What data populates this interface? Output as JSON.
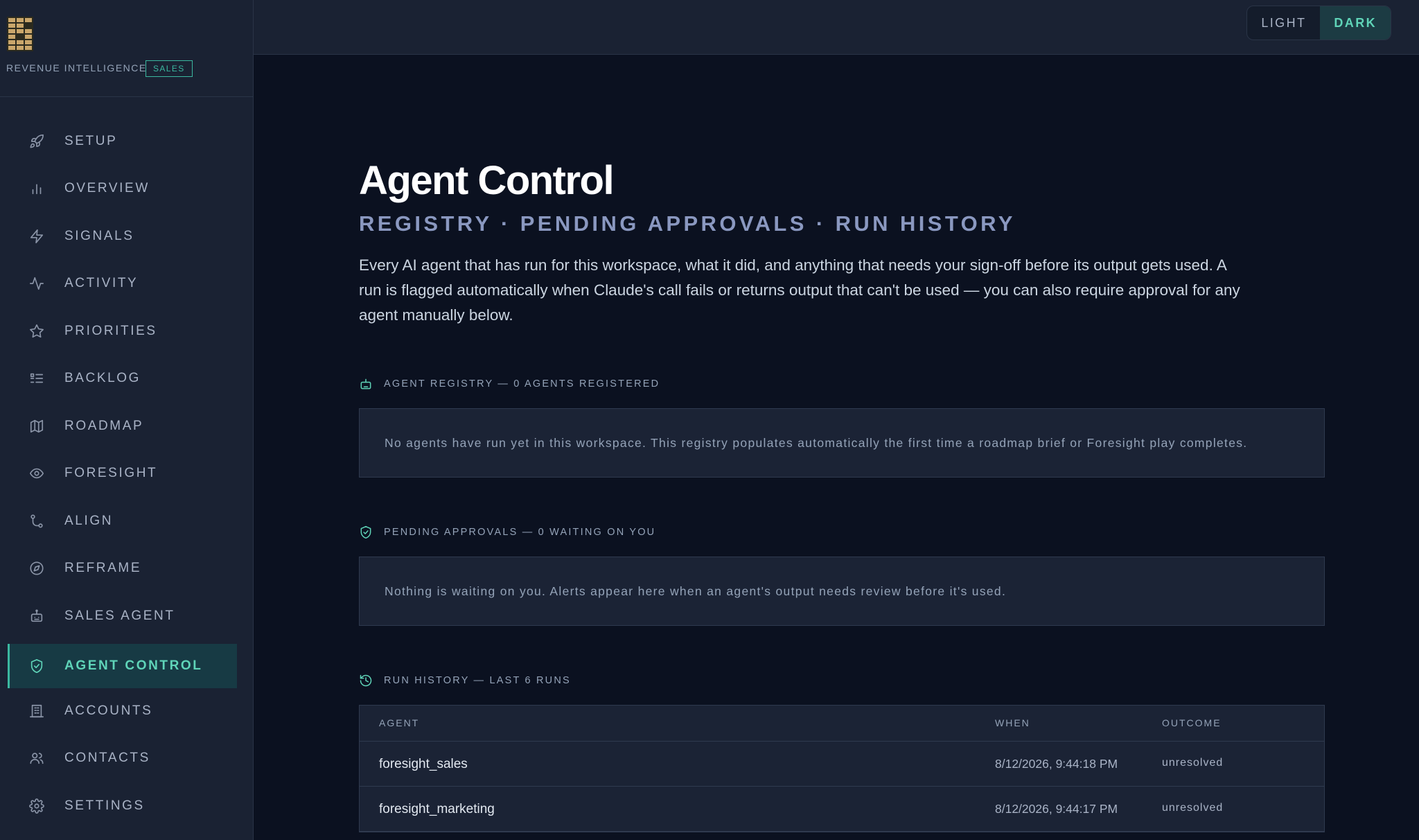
{
  "brand": {
    "name": "REVENUE INTELLIGENCE",
    "badge": "SALES"
  },
  "sidebar": {
    "items": [
      {
        "label": "SETUP",
        "icon": "rocket-icon"
      },
      {
        "label": "OVERVIEW",
        "icon": "bar-chart-icon"
      },
      {
        "label": "SIGNALS",
        "icon": "lightning-icon"
      },
      {
        "label": "ACTIVITY",
        "icon": "pulse-icon"
      },
      {
        "label": "PRIORITIES",
        "icon": "star-icon"
      },
      {
        "label": "BACKLOG",
        "icon": "list-check-icon"
      },
      {
        "label": "ROADMAP",
        "icon": "map-icon"
      },
      {
        "label": "FORESIGHT",
        "icon": "eye-icon"
      },
      {
        "label": "ALIGN",
        "icon": "route-icon"
      },
      {
        "label": "REFRAME",
        "icon": "compass-icon"
      },
      {
        "label": "SALES AGENT",
        "icon": "robot-icon"
      },
      {
        "label": "AGENT CONTROL",
        "icon": "shield-check-icon",
        "active": true
      },
      {
        "label": "ACCOUNTS",
        "icon": "building-icon"
      },
      {
        "label": "CONTACTS",
        "icon": "users-icon"
      },
      {
        "label": "SETTINGS",
        "icon": "gear-icon"
      }
    ]
  },
  "theme": {
    "light_label": "LIGHT",
    "dark_label": "DARK",
    "selected": "DARK"
  },
  "page": {
    "title": "Agent Control",
    "subtitle": "REGISTRY · PENDING APPROVALS · RUN HISTORY",
    "description": "Every AI agent that has run for this workspace, what it did, and anything that needs your sign-off before its output gets used. A run is flagged automatically when Claude's call fails or returns output that can't be used — you can also require approval for any agent manually below."
  },
  "registry": {
    "heading": "AGENT REGISTRY — 0 AGENTS REGISTERED",
    "empty_text": "No agents have run yet in this workspace. This registry populates automatically the first time a roadmap brief or Foresight play completes."
  },
  "approvals": {
    "heading": "PENDING APPROVALS — 0 WAITING ON YOU",
    "empty_text": "Nothing is waiting on you. Alerts appear here when an agent's output needs review before it's used."
  },
  "history": {
    "heading": "RUN HISTORY — LAST 6 RUNS",
    "columns": [
      "AGENT",
      "WHEN",
      "OUTCOME"
    ],
    "rows": [
      {
        "agent": "foresight_sales",
        "when": "8/12/2026, 9:44:18 PM",
        "outcome": "unresolved"
      },
      {
        "agent": "foresight_marketing",
        "when": "8/12/2026, 9:44:17 PM",
        "outcome": "unresolved"
      }
    ]
  },
  "colors": {
    "background": "#0b1120",
    "sidebar": "#1a2233",
    "accent": "#5fd4b8",
    "active_bg": "#173a44"
  }
}
